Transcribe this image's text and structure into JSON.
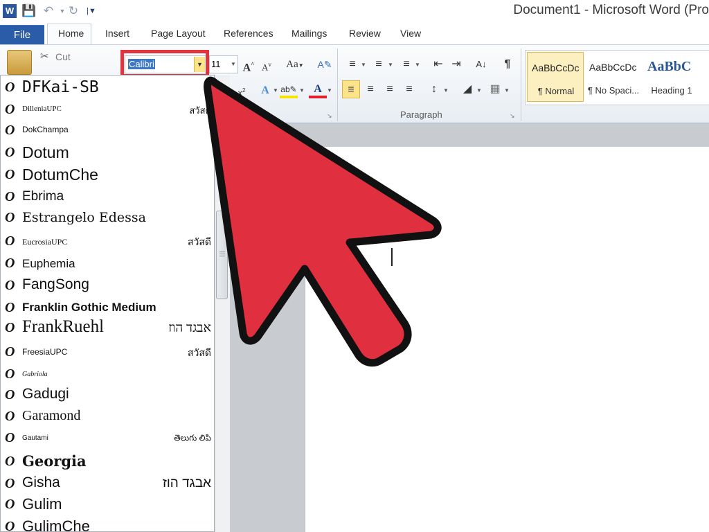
{
  "window": {
    "title": "Document1  -  Microsoft Word (Pro"
  },
  "tabs": [
    "File",
    "Home",
    "Insert",
    "Page Layout",
    "References",
    "Mailings",
    "Review",
    "View"
  ],
  "font_group": {
    "font_name": "Calibri",
    "font_size": "11",
    "clipboard_cut": "Cut"
  },
  "paragraph_group_label": "Paragraph",
  "styles": [
    {
      "sample": "AaBbCcDc",
      "name": "¶ Normal"
    },
    {
      "sample": "AaBbCcDc",
      "name": "¶ No Spaci..."
    },
    {
      "sample": "AaBbC",
      "name": "Heading 1"
    }
  ],
  "font_list": [
    {
      "name": "DFKai-SB",
      "sample": ""
    },
    {
      "name": "DilleniaUPC",
      "sample": "สวัสดี"
    },
    {
      "name": "DokChampa",
      "sample": ""
    },
    {
      "name": "Dotum",
      "sample": ""
    },
    {
      "name": "DotumChe",
      "sample": ""
    },
    {
      "name": "Ebrima",
      "sample": ""
    },
    {
      "name": "Estrangelo Edessa",
      "sample": ""
    },
    {
      "name": "EucrosiaUPC",
      "sample": "สวัสดี"
    },
    {
      "name": "Euphemia",
      "sample": ""
    },
    {
      "name": "FangSong",
      "sample": ""
    },
    {
      "name": "Franklin Gothic Medium",
      "sample": ""
    },
    {
      "name": "FrankRuehl",
      "sample": "אבגד הוז"
    },
    {
      "name": "FreesiaUPC",
      "sample": "สวัสดี"
    },
    {
      "name": "Gabriola",
      "sample": ""
    },
    {
      "name": "Gadugi",
      "sample": ""
    },
    {
      "name": "Garamond",
      "sample": ""
    },
    {
      "name": "Gautami",
      "sample": "తెలుగు లిపి"
    },
    {
      "name": "Georgia",
      "sample": ""
    },
    {
      "name": "Gisha",
      "sample": "אבגד הוז"
    },
    {
      "name": "Gulim",
      "sample": ""
    },
    {
      "name": "GulimChe",
      "sample": ""
    }
  ],
  "colors": {
    "file_tab": "#2a5ca8",
    "highlight_box": "#e0353f",
    "arrow_fill": "#e03040",
    "selection": "#3d78c4"
  }
}
